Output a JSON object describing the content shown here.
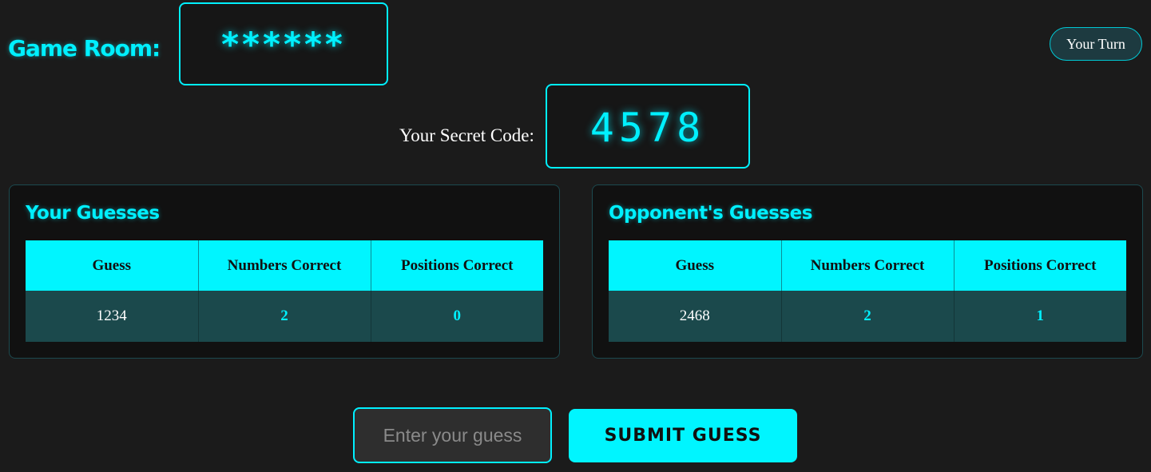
{
  "header": {
    "room_label": "Game Room:",
    "room_code": "******",
    "turn_status": "Your Turn"
  },
  "secret": {
    "label": "Your Secret Code:",
    "code": "4578"
  },
  "your_guesses": {
    "title": "Your Guesses",
    "columns": [
      "Guess",
      "Numbers Correct",
      "Positions Correct"
    ],
    "rows": [
      {
        "guess": "1234",
        "numbers_correct": "2",
        "positions_correct": "0"
      }
    ]
  },
  "opponent_guesses": {
    "title": "Opponent's Guesses",
    "columns": [
      "Guess",
      "Numbers Correct",
      "Positions Correct"
    ],
    "rows": [
      {
        "guess": "2468",
        "numbers_correct": "2",
        "positions_correct": "1"
      }
    ]
  },
  "guess_form": {
    "placeholder": "Enter your guess",
    "value": "",
    "submit_label": "SUBMIT GUESS"
  },
  "colors": {
    "accent": "#00f0ff",
    "background": "#1b1b1b",
    "panel": "#111111",
    "row": "#1b494c"
  }
}
